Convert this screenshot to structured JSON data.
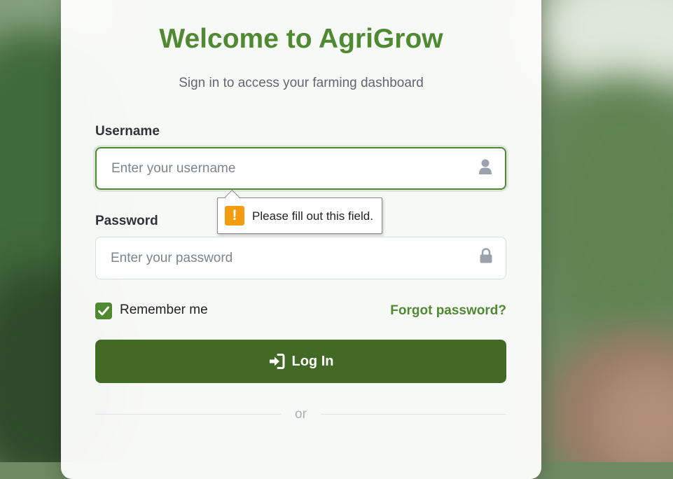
{
  "header": {
    "title": "Welcome to AgriGrow",
    "subtitle": "Sign in to access your farming dashboard"
  },
  "form": {
    "username_label": "Username",
    "username_placeholder": "Enter your username",
    "username_value": "",
    "username_icon": "user-icon",
    "password_label": "Password",
    "password_placeholder": "Enter your password",
    "password_value": "",
    "password_icon": "lock-icon",
    "remember_label": "Remember me",
    "remember_checked": true,
    "forgot_label": "Forgot password?",
    "login_label": "Log In",
    "login_icon": "sign-in-icon",
    "divider_label": "or"
  },
  "validation": {
    "message": "Please fill out this field.",
    "icon": "warning-icon"
  },
  "colors": {
    "brand_green": "#4f8a33",
    "button_green": "#436a25",
    "warning_orange": "#f39c12"
  }
}
